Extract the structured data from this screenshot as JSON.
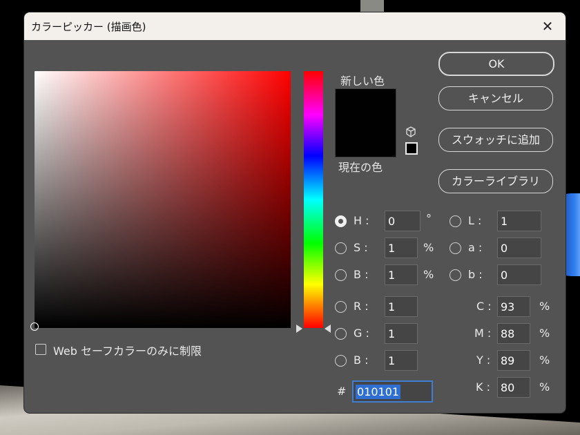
{
  "dialog": {
    "title": "カラーピッカー (描画色)",
    "close_glyph": "✕"
  },
  "swatch": {
    "new_label": "新しい色",
    "current_label": "現在の色",
    "color": "#010101"
  },
  "buttons": {
    "ok": "OK",
    "cancel": "キャンセル",
    "add_swatch": "スウォッチに追加",
    "color_library": "カラーライブラリ"
  },
  "hsb": {
    "h_label": "H :",
    "h_value": "0",
    "h_unit": "°",
    "s_label": "S :",
    "s_value": "1",
    "s_unit": "%",
    "b_label": "B :",
    "b_value": "1",
    "b_unit": "%",
    "selected": "H"
  },
  "rgb": {
    "r_label": "R :",
    "r_value": "1",
    "g_label": "G :",
    "g_value": "1",
    "b_label": "B :",
    "b_value": "1"
  },
  "lab": {
    "l_label": "L :",
    "l_value": "1",
    "a_label": "a :",
    "a_value": "0",
    "b_label": "b :",
    "b_value": "0"
  },
  "cmyk": {
    "c_label": "C :",
    "c_value": "93",
    "m_label": "M :",
    "m_value": "88",
    "y_label": "Y :",
    "y_value": "89",
    "k_label": "K :",
    "k_value": "80",
    "unit": "%"
  },
  "hex": {
    "label": "#",
    "value": "010101"
  },
  "web_safe_label": "Web セーフカラーのみに制限",
  "colors": {
    "dialog_bg": "#535353",
    "hue": "#ff0000",
    "selection": "#2f6fd1"
  }
}
